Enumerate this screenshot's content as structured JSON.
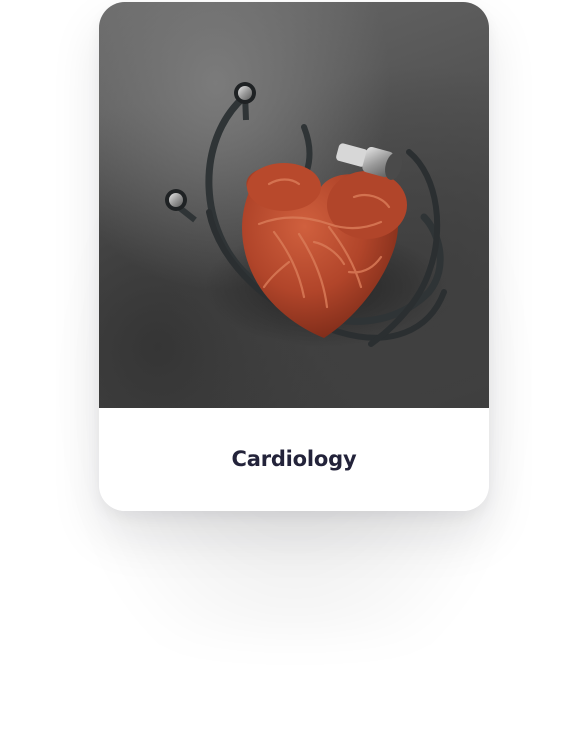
{
  "card": {
    "title": "Cardiology",
    "image_icon": "heart-with-stethoscope-icon"
  },
  "colors": {
    "title": "#23233a",
    "heart": "#b6472b",
    "background_dark": "#3f3f3f",
    "stethoscope": "#2f3436"
  }
}
